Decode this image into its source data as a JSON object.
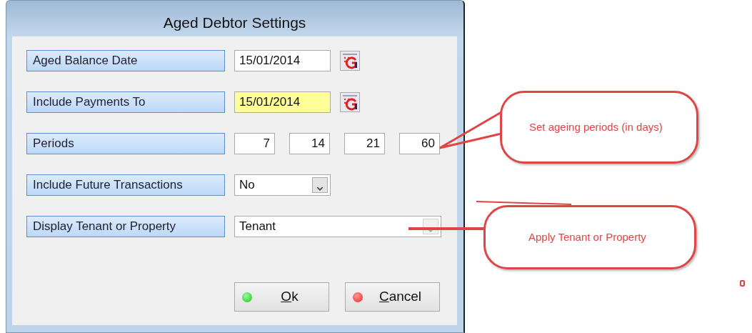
{
  "window": {
    "title": "Aged Debtor Settings"
  },
  "fields": [
    {
      "kind": "date",
      "label": "Aged Balance Date",
      "value": "15/01/2014",
      "highlighted": false
    },
    {
      "kind": "date",
      "label": "Include Payments To",
      "value": "15/01/2014",
      "highlighted": true
    },
    {
      "kind": "periods",
      "label": "Periods",
      "values": [
        "7",
        "14",
        "21",
        "60"
      ]
    },
    {
      "kind": "select",
      "label": "Include Future Transactions",
      "value": "No",
      "wide": false
    },
    {
      "kind": "select",
      "label": "Display Tenant or Property",
      "value": "Tenant",
      "wide": true
    }
  ],
  "buttons": [
    {
      "kind": "ok",
      "label": "Ok"
    },
    {
      "kind": "cancel",
      "label": "Cancel"
    }
  ],
  "annotations": [
    {
      "kind": "bubble-pointer",
      "text": "Set ageing periods (in days)"
    },
    {
      "kind": "bubble-line",
      "text": "Apply Tenant or Property"
    }
  ]
}
